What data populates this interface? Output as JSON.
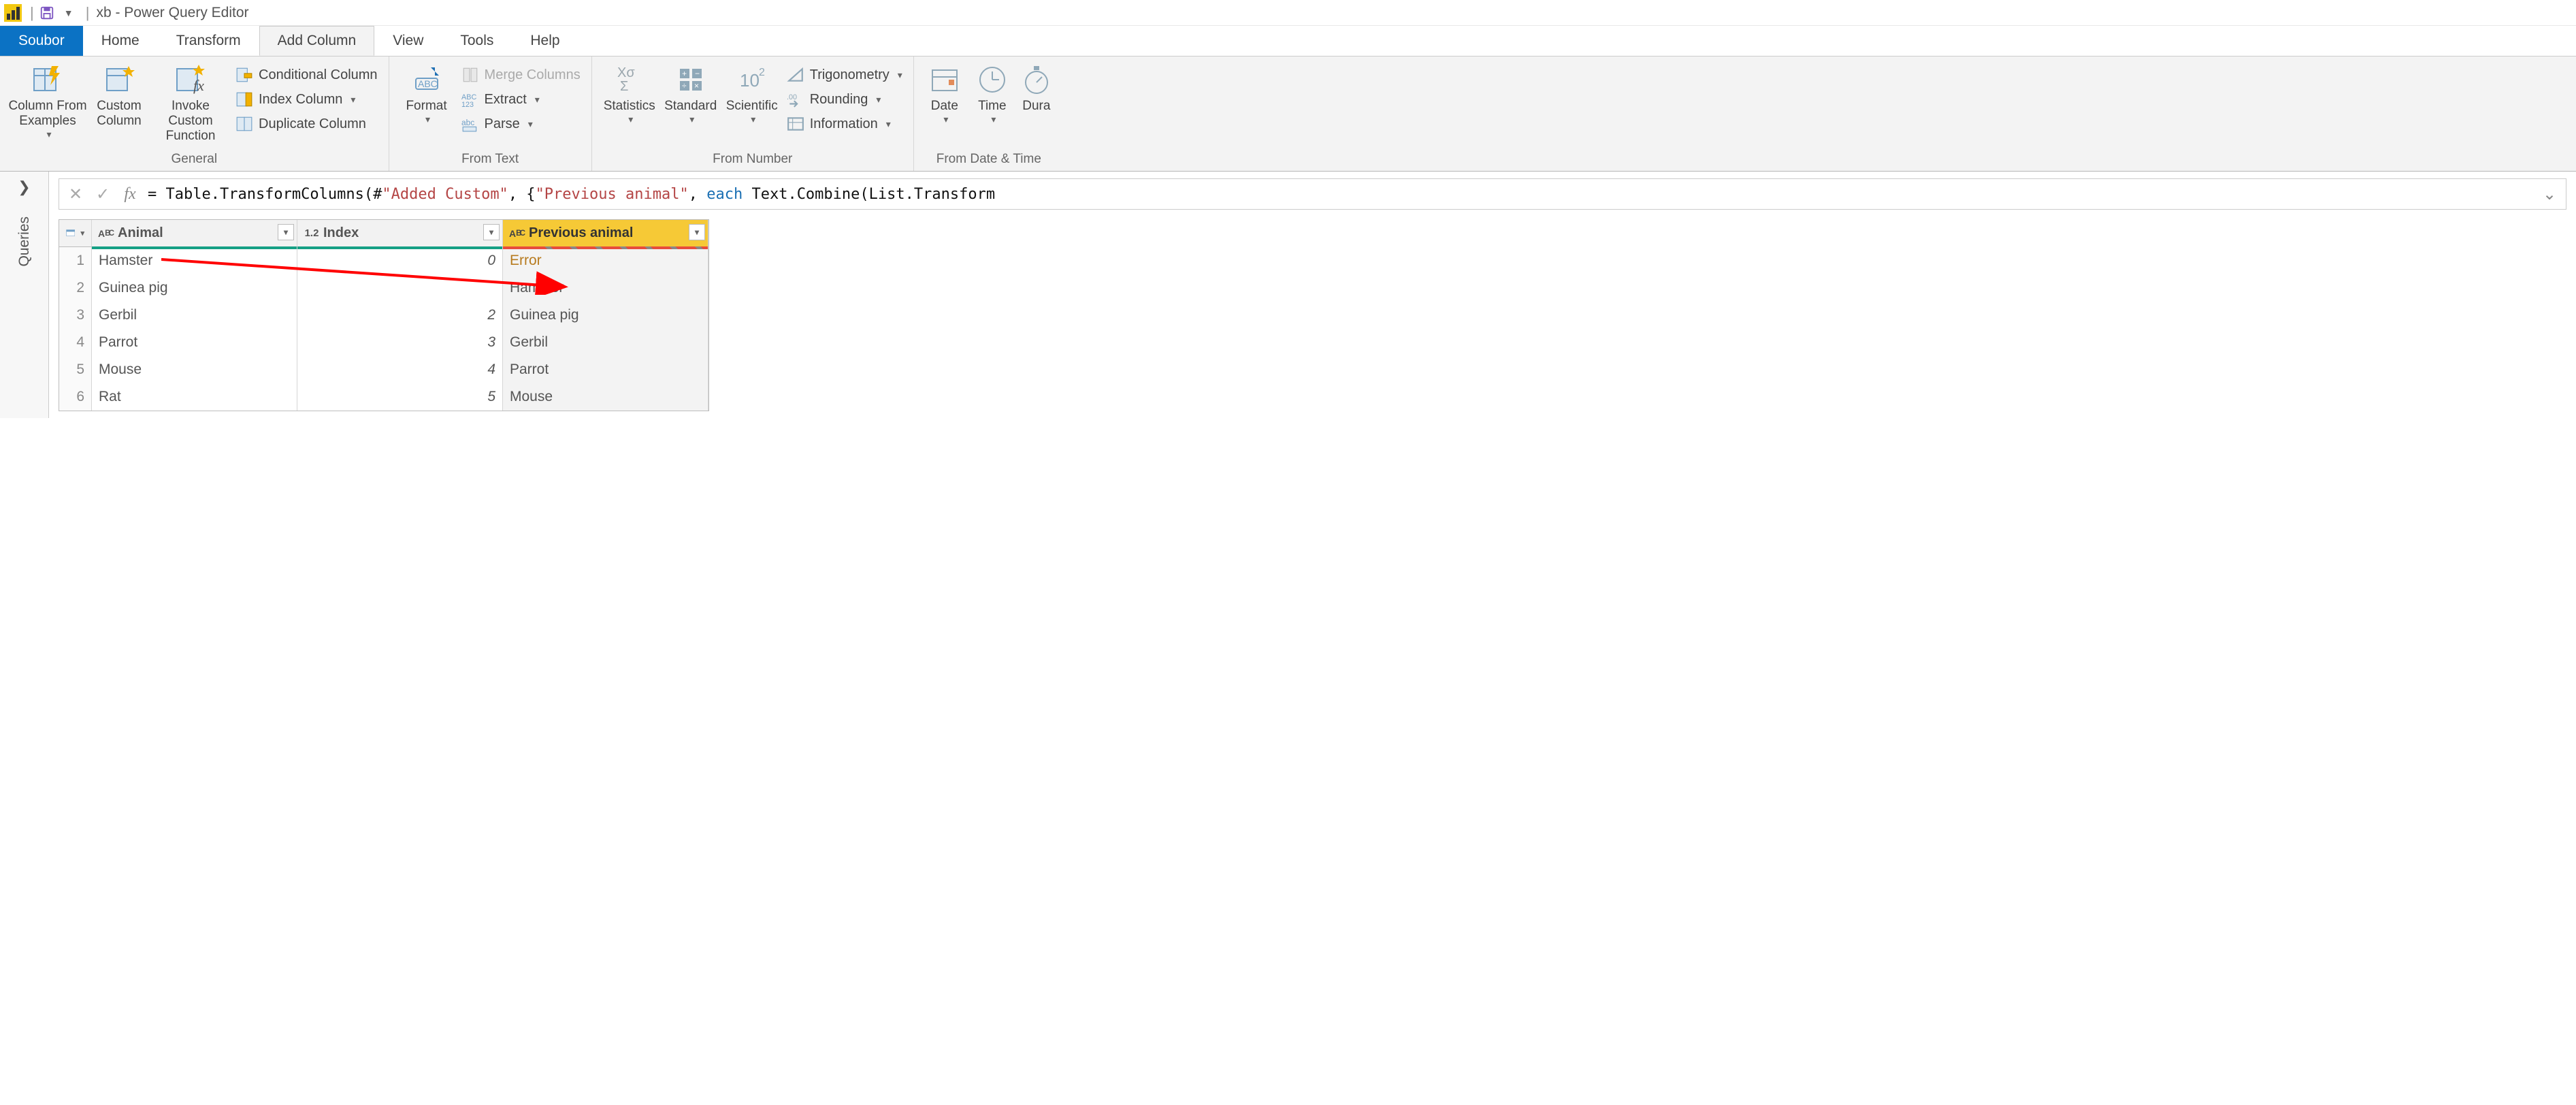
{
  "title": "xb - Power Query Editor",
  "tabs": {
    "file": "Soubor",
    "home": "Home",
    "transform": "Transform",
    "add_column": "Add Column",
    "view": "View",
    "tools": "Tools",
    "help": "Help"
  },
  "ribbon": {
    "general": {
      "label": "General",
      "column_from_examples": "Column From Examples",
      "custom_column": "Custom Column",
      "invoke_custom_function": "Invoke Custom Function",
      "conditional_column": "Conditional Column",
      "index_column": "Index Column",
      "duplicate_column": "Duplicate Column"
    },
    "from_text": {
      "label": "From Text",
      "format": "Format",
      "merge_columns": "Merge Columns",
      "extract": "Extract",
      "parse": "Parse"
    },
    "from_number": {
      "label": "From Number",
      "statistics": "Statistics",
      "standard": "Standard",
      "scientific": "Scientific",
      "trigonometry": "Trigonometry",
      "rounding": "Rounding",
      "information": "Information"
    },
    "from_datetime": {
      "label": "From Date & Time",
      "date": "Date",
      "time": "Time",
      "duration": "Dura"
    }
  },
  "queries_label": "Queries",
  "formula": {
    "prefix": "= Table.TransformColumns(#",
    "q1": "\"Added Custom\"",
    "mid1": ", {",
    "q2": "\"Previous animal\"",
    "mid2": ", ",
    "kw": "each",
    "rest": " Text.Combine(List.Transform"
  },
  "columns": {
    "animal": "Animal",
    "index": "Index",
    "previous": "Previous animal"
  },
  "rows": [
    {
      "n": "1",
      "animal": "Hamster",
      "index": "0",
      "prev": "Error",
      "err": true
    },
    {
      "n": "2",
      "animal": "Guinea pig",
      "index": "",
      "prev": "Hamster",
      "err": false
    },
    {
      "n": "3",
      "animal": "Gerbil",
      "index": "2",
      "prev": "Guinea pig",
      "err": false
    },
    {
      "n": "4",
      "animal": "Parrot",
      "index": "3",
      "prev": "Gerbil",
      "err": false
    },
    {
      "n": "5",
      "animal": "Mouse",
      "index": "4",
      "prev": "Parrot",
      "err": false
    },
    {
      "n": "6",
      "animal": "Rat",
      "index": "5",
      "prev": "Mouse",
      "err": false
    }
  ]
}
